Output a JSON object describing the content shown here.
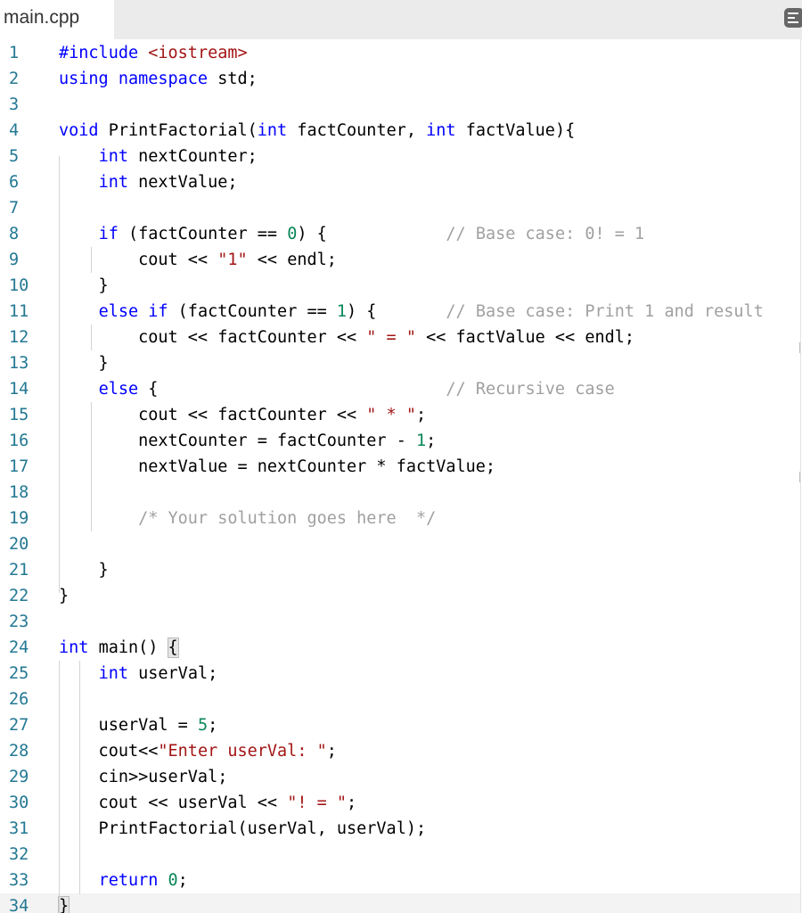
{
  "tab": {
    "filename": "main.cpp"
  },
  "toolbar": {
    "menu_icon": "menu-icon"
  },
  "colors": {
    "keyword": "#0000ff",
    "string": "#a31515",
    "number": "#098658",
    "comment": "#a0a0a0",
    "line_number": "#237893"
  },
  "lines": [
    {
      "n": "1",
      "t": [
        [
          "pp",
          "#include "
        ],
        [
          "inc",
          "<iostream>"
        ]
      ]
    },
    {
      "n": "2",
      "t": [
        [
          "kw",
          "using namespace "
        ],
        [
          "",
          "std;"
        ]
      ]
    },
    {
      "n": "3",
      "t": []
    },
    {
      "n": "4",
      "t": [
        [
          "kw",
          "void "
        ],
        [
          "",
          "PrintFactorial("
        ],
        [
          "kw",
          "int "
        ],
        [
          "",
          "factCounter, "
        ],
        [
          "kw",
          "int "
        ],
        [
          "",
          "factValue){"
        ]
      ]
    },
    {
      "n": "5",
      "t": [
        [
          "",
          "    "
        ],
        [
          "kw",
          "int "
        ],
        [
          "",
          "nextCounter;"
        ]
      ]
    },
    {
      "n": "6",
      "t": [
        [
          "",
          "    "
        ],
        [
          "kw",
          "int "
        ],
        [
          "",
          "nextValue;"
        ]
      ]
    },
    {
      "n": "7",
      "t": []
    },
    {
      "n": "8",
      "t": [
        [
          "",
          "    "
        ],
        [
          "kw",
          "if "
        ],
        [
          "",
          "(factCounter == "
        ],
        [
          "num",
          "0"
        ],
        [
          "",
          ") {            "
        ],
        [
          "cmt",
          "// Base case: 0! = 1"
        ]
      ]
    },
    {
      "n": "9",
      "t": [
        [
          "",
          "        cout << "
        ],
        [
          "str",
          "\"1\""
        ],
        [
          "",
          " << endl;"
        ]
      ]
    },
    {
      "n": "10",
      "t": [
        [
          "",
          "    }"
        ]
      ]
    },
    {
      "n": "11",
      "t": [
        [
          "",
          "    "
        ],
        [
          "kw",
          "else if "
        ],
        [
          "",
          "(factCounter == "
        ],
        [
          "num",
          "1"
        ],
        [
          "",
          ") {       "
        ],
        [
          "cmt",
          "// Base case: Print 1 and result"
        ]
      ]
    },
    {
      "n": "12",
      "t": [
        [
          "",
          "        cout << factCounter << "
        ],
        [
          "str",
          "\" = \""
        ],
        [
          "",
          " << factValue << endl;"
        ]
      ]
    },
    {
      "n": "13",
      "t": [
        [
          "",
          "    }"
        ]
      ]
    },
    {
      "n": "14",
      "t": [
        [
          "",
          "    "
        ],
        [
          "kw",
          "else "
        ],
        [
          "",
          "{                             "
        ],
        [
          "cmt",
          "// Recursive case"
        ]
      ]
    },
    {
      "n": "15",
      "t": [
        [
          "",
          "        cout << factCounter << "
        ],
        [
          "str",
          "\" * \""
        ],
        [
          "",
          ";"
        ]
      ]
    },
    {
      "n": "16",
      "t": [
        [
          "",
          "        nextCounter = factCounter - "
        ],
        [
          "num",
          "1"
        ],
        [
          "",
          ";"
        ]
      ]
    },
    {
      "n": "17",
      "t": [
        [
          "",
          "        nextValue = nextCounter * factValue;"
        ]
      ]
    },
    {
      "n": "18",
      "t": []
    },
    {
      "n": "19",
      "t": [
        [
          "",
          "        "
        ],
        [
          "cmt",
          "/* Your solution goes here  */"
        ]
      ]
    },
    {
      "n": "20",
      "t": []
    },
    {
      "n": "21",
      "t": [
        [
          "",
          "    }"
        ]
      ]
    },
    {
      "n": "22",
      "t": [
        [
          "",
          "}"
        ]
      ]
    },
    {
      "n": "23",
      "t": []
    },
    {
      "n": "24",
      "t": [
        [
          "kw",
          "int "
        ],
        [
          "",
          "main() "
        ],
        [
          "bm",
          "{"
        ]
      ]
    },
    {
      "n": "25",
      "t": [
        [
          "",
          "    "
        ],
        [
          "kw",
          "int "
        ],
        [
          "",
          "userVal;"
        ]
      ]
    },
    {
      "n": "26",
      "t": []
    },
    {
      "n": "27",
      "t": [
        [
          "",
          "    userVal = "
        ],
        [
          "num",
          "5"
        ],
        [
          "",
          ";"
        ]
      ]
    },
    {
      "n": "28",
      "t": [
        [
          "",
          "    cout<<"
        ],
        [
          "str",
          "\"Enter userVal: \""
        ],
        [
          "",
          ";"
        ]
      ]
    },
    {
      "n": "29",
      "t": [
        [
          "",
          "    cin>>userVal;"
        ]
      ]
    },
    {
      "n": "30",
      "t": [
        [
          "",
          "    cout << userVal << "
        ],
        [
          "str",
          "\"! = \""
        ],
        [
          "",
          ";"
        ]
      ]
    },
    {
      "n": "31",
      "t": [
        [
          "",
          "    PrintFactorial(userVal, userVal);"
        ]
      ]
    },
    {
      "n": "32",
      "t": []
    },
    {
      "n": "33",
      "t": [
        [
          "",
          "    "
        ],
        [
          "kw",
          "return "
        ],
        [
          "num",
          "0"
        ],
        [
          "",
          ";"
        ]
      ]
    },
    {
      "n": "34",
      "t": [
        [
          "bm",
          "}"
        ]
      ]
    }
  ]
}
